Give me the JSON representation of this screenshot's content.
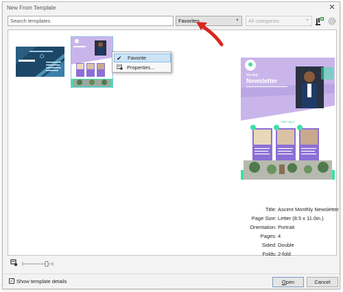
{
  "window": {
    "title": "New From Template"
  },
  "toolbar": {
    "search_placeholder": "Search templates",
    "filter_selected": "Favorites",
    "category_selected": "All categories"
  },
  "context_menu": {
    "items": [
      {
        "label": "Favorite",
        "checked": true
      },
      {
        "label": "Properties..."
      }
    ]
  },
  "templates": [
    {
      "kind": "business-card",
      "name_text": "JOHN SMITH",
      "title_text": "ASCENDANT BRAND"
    },
    {
      "kind": "newsletter",
      "favorite": true
    }
  ],
  "preview": {
    "heading_small": "Monthly",
    "heading": "Newsletter",
    "subheading": "Staff Digest"
  },
  "details": {
    "title_label": "Title:",
    "title_value": "Ascent Monthly Newsletter",
    "pagesize_label": "Page Size:",
    "pagesize_value": "Letter (8.5 x 11.0in.)",
    "orientation_label": "Orientation:",
    "orientation_value": "Portrait",
    "pages_label": "Pages:",
    "pages_value": "4",
    "sided_label": "Sided:",
    "sided_value": "Double",
    "folds_label": "Folds:",
    "folds_value": "2-fold"
  },
  "footer": {
    "show_details_label": "Show template details",
    "show_details_checked": true,
    "open_label_first": "O",
    "open_label_rest": "pen",
    "cancel_label": "Cancel"
  },
  "colors": {
    "accent_lavender": "#c9b5ea",
    "accent_purple": "#8c6fd6",
    "accent_green": "#3ee0a5",
    "card_navy": "#1d4766",
    "annotation_arrow": "#d9261c"
  }
}
